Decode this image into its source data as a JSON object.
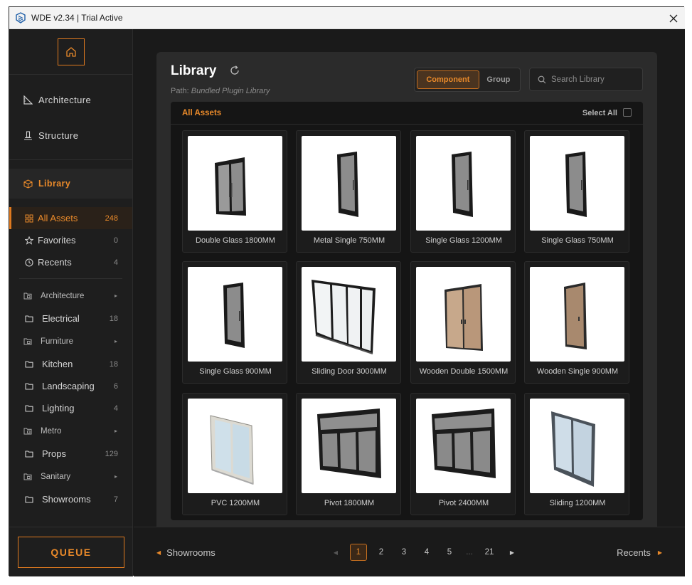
{
  "window": {
    "title": "WDE v2.34 | Trial Active"
  },
  "sidebar": {
    "main_items": [
      {
        "label": "Architecture",
        "icon": "ruler-triangle-icon"
      },
      {
        "label": "Structure",
        "icon": "structure-icon"
      }
    ],
    "library_label": "Library",
    "quick": [
      {
        "label": "All Assets",
        "count": "248",
        "icon": "grid-icon",
        "active": true
      },
      {
        "label": "Favorites",
        "count": "0",
        "icon": "star-icon"
      },
      {
        "label": "Recents",
        "count": "4",
        "icon": "clock-icon"
      }
    ],
    "categories": [
      {
        "label": "Architecture",
        "type": "group",
        "arrow": "▸"
      },
      {
        "label": "Electrical",
        "type": "folder",
        "count": "18"
      },
      {
        "label": "Furniture",
        "type": "group",
        "arrow": "▸"
      },
      {
        "label": "Kitchen",
        "type": "folder",
        "count": "18"
      },
      {
        "label": "Landscaping",
        "type": "folder",
        "count": "6"
      },
      {
        "label": "Lighting",
        "type": "folder",
        "count": "4"
      },
      {
        "label": "Metro",
        "type": "group",
        "arrow": "▸"
      },
      {
        "label": "Props",
        "type": "folder",
        "count": "129"
      },
      {
        "label": "Sanitary",
        "type": "group",
        "arrow": "▸"
      },
      {
        "label": "Showrooms",
        "type": "folder",
        "count": "7"
      }
    ],
    "queue_label": "QUEUE"
  },
  "library": {
    "title": "Library",
    "path_prefix": "Path:",
    "path": "Bundled Plugin Library",
    "toggle": {
      "component": "Component",
      "group": "Group",
      "selected": "Component"
    },
    "search_placeholder": "Search Library",
    "section": "All Assets",
    "select_all": "Select All",
    "items": [
      {
        "label": "Double Glass 1800MM",
        "kind": "door-double-glass"
      },
      {
        "label": "Metal Single 750MM",
        "kind": "door-single-glass"
      },
      {
        "label": "Single Glass 1200MM",
        "kind": "door-single-glass"
      },
      {
        "label": "Single Glass 750MM",
        "kind": "door-single-glass"
      },
      {
        "label": "Single Glass 900MM",
        "kind": "door-single-glass"
      },
      {
        "label": "Sliding Door 3000MM",
        "kind": "sliding-door"
      },
      {
        "label": "Wooden Double 1500MM",
        "kind": "door-wooden-double"
      },
      {
        "label": "Wooden Single 900MM",
        "kind": "door-wooden-single"
      },
      {
        "label": "PVC 1200MM",
        "kind": "window-pvc"
      },
      {
        "label": "Pivot 1800MM",
        "kind": "window-pivot"
      },
      {
        "label": "Pivot 2400MM",
        "kind": "window-pivot"
      },
      {
        "label": "Sliding 1200MM",
        "kind": "window-sliding"
      }
    ]
  },
  "footer": {
    "prev_label": "Showrooms",
    "next_label": "Recents",
    "pages": [
      "1",
      "2",
      "3",
      "4",
      "5",
      "...",
      "21"
    ],
    "current_page": "1"
  },
  "colors": {
    "accent": "#e8892a",
    "background": "#1a1a1a",
    "panel": "#2b2b2b"
  }
}
